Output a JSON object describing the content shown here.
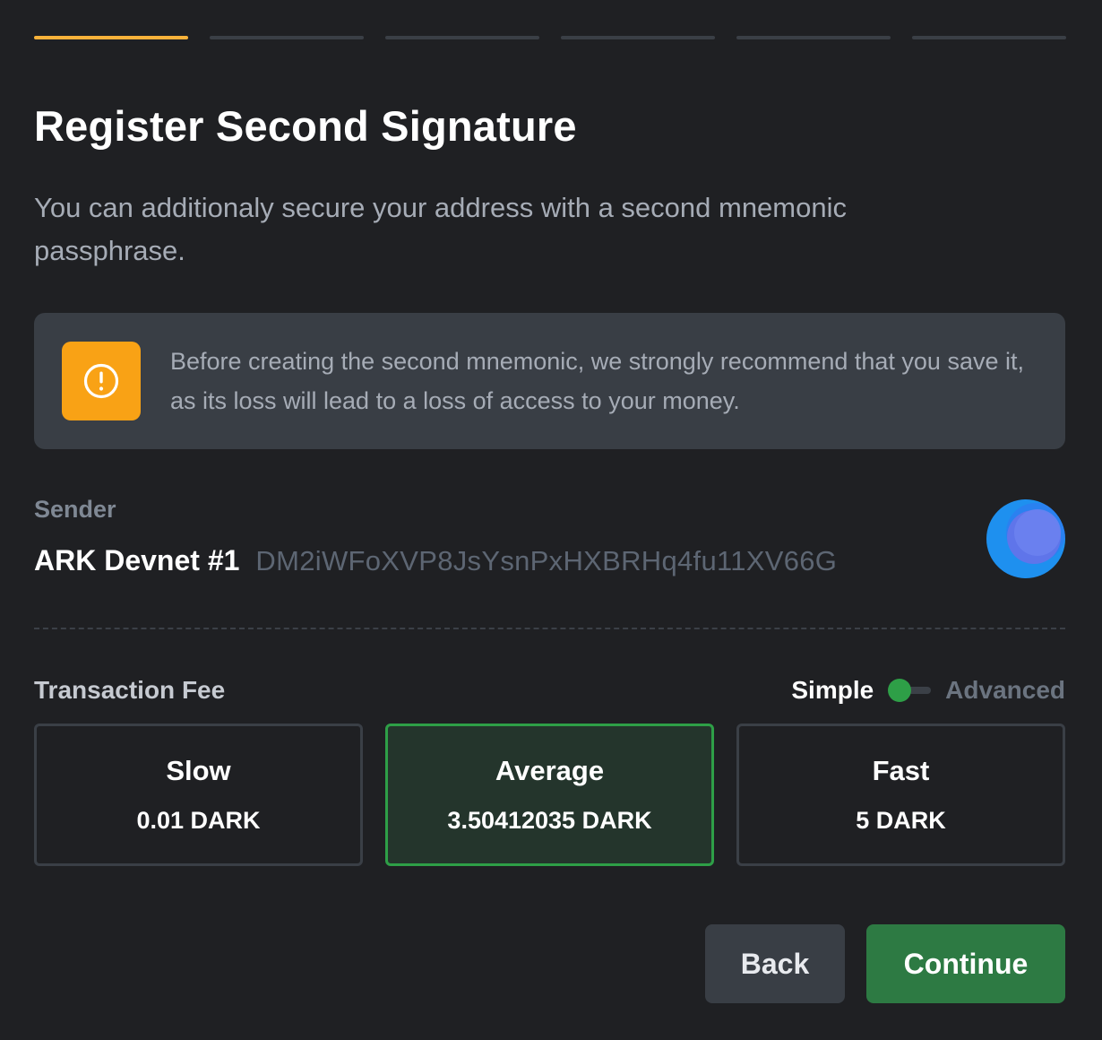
{
  "stepper": {
    "total": 6,
    "current": 1
  },
  "header": {
    "title": "Register Second Signature",
    "subtitle": "You can additionaly secure your address with a second mnemonic passphrase."
  },
  "alert": {
    "icon": "warning-icon",
    "text": "Before creating the second mnemonic, we strongly recommend that you save it, as its loss will lead to a loss of access to your money."
  },
  "sender": {
    "label": "Sender",
    "wallet_name": "ARK Devnet #1",
    "address": "DM2iWFoXVP8JsYsnPxHXBRHq4fu11XV66G"
  },
  "fee": {
    "label": "Transaction Fee",
    "toggle": {
      "simple": "Simple",
      "advanced": "Advanced",
      "mode": "simple"
    },
    "options": [
      {
        "name": "Slow",
        "amount": "0.01 DARK",
        "selected": false
      },
      {
        "name": "Average",
        "amount": "3.50412035 DARK",
        "selected": true
      },
      {
        "name": "Fast",
        "amount": "5 DARK",
        "selected": false
      }
    ]
  },
  "actions": {
    "back": "Back",
    "continue": "Continue"
  },
  "colors": {
    "accent_warning": "#f9a215",
    "step_active": "#f8b23a",
    "success": "#2e9f47",
    "continue_bg": "#2d7a43"
  }
}
